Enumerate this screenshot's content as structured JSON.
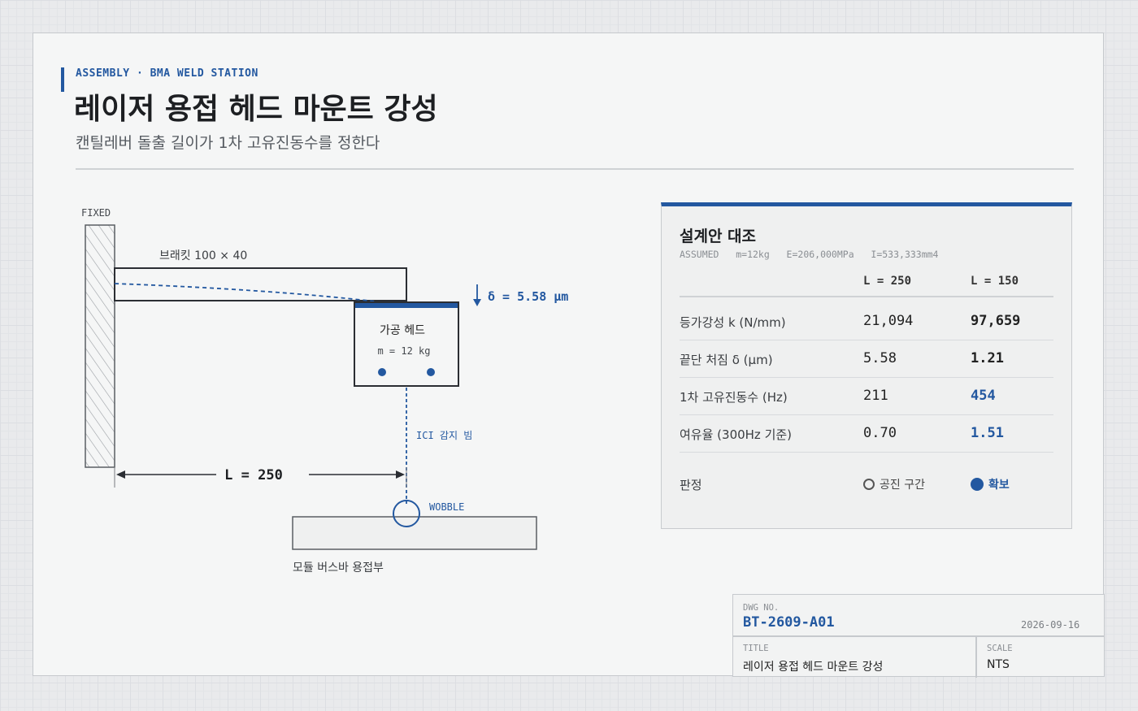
{
  "header": {
    "eyebrow": "ASSEMBLY · BMA WELD STATION",
    "title": "레이저 용접 헤드 마운트 강성",
    "subtitle": "캔틸레버 돌출 길이가 1차 고유진동수를 정한다"
  },
  "diagram": {
    "fixed_label": "FIXED",
    "bracket_label": "브래킷 100 × 40",
    "deflection_label": "δ = 5.58 μm",
    "head_title": "가공 헤드",
    "head_mass": "m = 12 kg",
    "beam_label": "ICI 감지 빔",
    "length_label": "L = 250",
    "wobble_label": "WOBBLE",
    "busbar_label": "모듈 버스바 용접부",
    "colors": {
      "accent": "#2358a0",
      "line": "#2b2e33",
      "hatch": "#9a9ea3"
    }
  },
  "panel": {
    "title": "설계안 대조",
    "assumed": "ASSUMED   m=12kg   E=206,000MPa   I=533,333mm4",
    "columns": [
      "L = 250",
      "L = 150"
    ],
    "rows": [
      {
        "label": "등가강성 k (N/mm)",
        "a": "21,094",
        "b": "97,659",
        "b_highlight": false
      },
      {
        "label": "끝단 처짐 δ (μm)",
        "a": "5.58",
        "b": "1.21",
        "b_highlight": false
      },
      {
        "label": "1차 고유진동수 (Hz)",
        "a": "211",
        "b": "454",
        "b_highlight": true
      },
      {
        "label": "여유율 (300Hz 기준)",
        "a": "0.70",
        "b": "1.51",
        "b_highlight": true
      }
    ],
    "verdict_label": "판정",
    "verdict_a": "공진 구간",
    "verdict_b": "확보"
  },
  "title_block": {
    "dwg_key": "DWG NO.",
    "dwg_no": "BT-2609-A01",
    "date": "2026-09-16",
    "title_key": "TITLE",
    "title_val": "레이저 용접 헤드 마운트 강성",
    "scale_key": "SCALE",
    "scale_val": "NTS"
  }
}
